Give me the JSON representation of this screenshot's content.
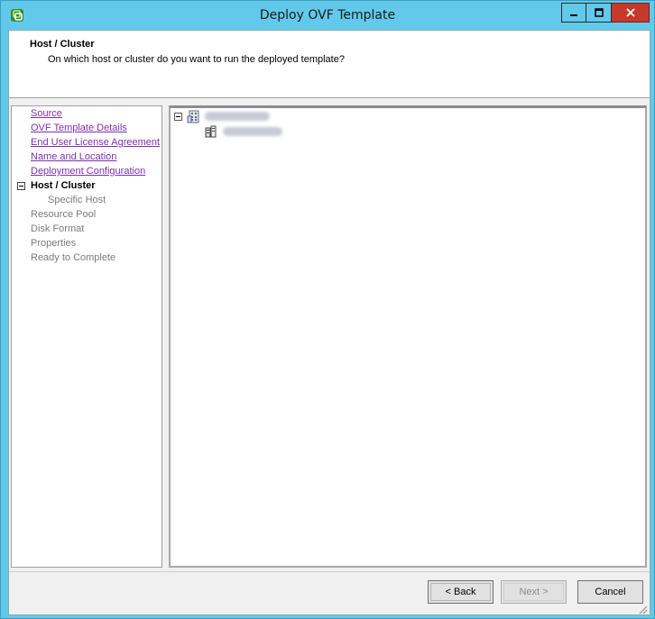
{
  "window": {
    "title": "Deploy OVF Template",
    "icon": "vsphere-logo-icon",
    "accent_color": "#63c9ea",
    "close_color": "#c73a2b"
  },
  "header": {
    "title": "Host / Cluster",
    "subtitle": "On which host or cluster do you want to run the deployed template?"
  },
  "steps": {
    "items": [
      {
        "label": "Source",
        "state": "link"
      },
      {
        "label": "OVF Template Details",
        "state": "link"
      },
      {
        "label": "End User License Agreement",
        "state": "link"
      },
      {
        "label": "Name and Location",
        "state": "link"
      },
      {
        "label": "Deployment Configuration",
        "state": "link"
      },
      {
        "label": "Host / Cluster",
        "state": "current"
      },
      {
        "label": "Specific Host",
        "state": "disabled"
      },
      {
        "label": "Resource Pool",
        "state": "disabled"
      },
      {
        "label": "Disk Format",
        "state": "disabled"
      },
      {
        "label": "Properties",
        "state": "disabled"
      },
      {
        "label": "Ready to Complete",
        "state": "disabled"
      }
    ]
  },
  "tree": {
    "datacenter_icon": "datacenter-icon",
    "cluster_icon": "cluster-icon"
  },
  "buttons": {
    "back": "< Back",
    "next": "Next >",
    "cancel": "Cancel"
  }
}
